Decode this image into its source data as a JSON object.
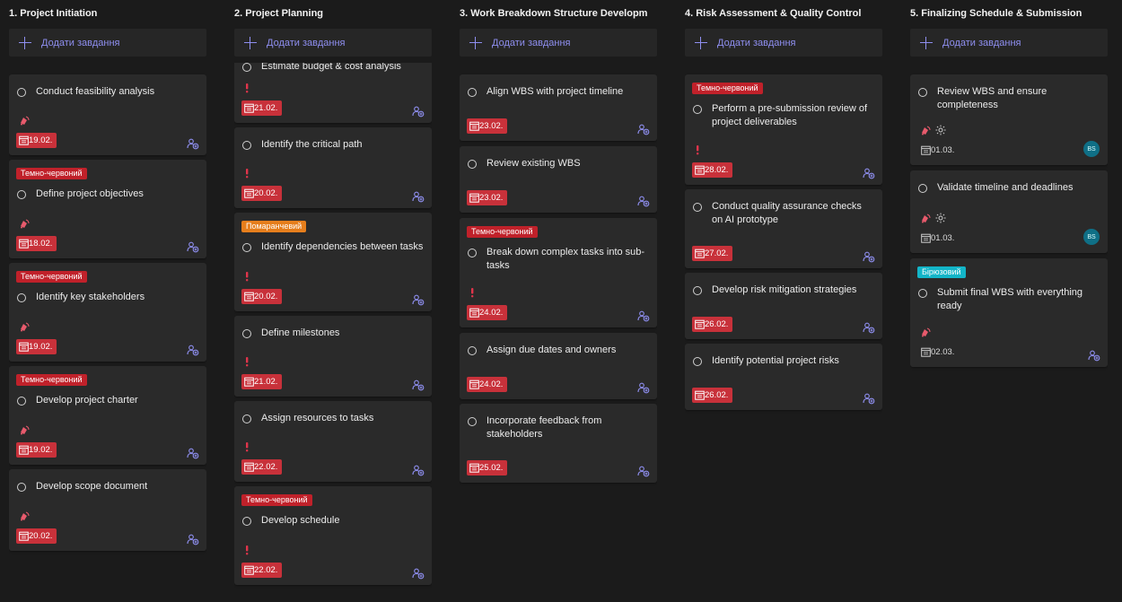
{
  "add_task_label": "Додати завдання",
  "colors": {
    "background": "#1b1b1b",
    "card": "#2a2a2a",
    "accent": "#8f8ff0",
    "date_overdue": "#c8313a",
    "label_dark_red": "#c0212a",
    "label_orange": "#e67e1c",
    "label_teal": "#13b5c8",
    "priority": "#e0344b"
  },
  "icons": {
    "add": "plus-icon",
    "complete": "circle-icon",
    "priority": "exclamation-icon",
    "urgent": "bell-icon",
    "low": "sun-icon",
    "due": "calendar-icon",
    "assign": "assign-person-icon"
  },
  "columns": [
    {
      "title": "1. Project Initiation",
      "cards": [
        {
          "title": "Conduct feasibility analysis",
          "icon": "bell",
          "due": "19.02."
        },
        {
          "label": "Темно-червоний",
          "label_color": "dark-red",
          "title": "Define project objectives",
          "icon": "bell",
          "due": "18.02."
        },
        {
          "label": "Темно-червоний",
          "label_color": "dark-red",
          "title": "Identify key stakeholders",
          "icon": "bell",
          "due": "19.02."
        },
        {
          "label": "Темно-червоний",
          "label_color": "dark-red",
          "title": "Develop project charter",
          "icon": "bell",
          "due": "19.02."
        },
        {
          "title": "Develop scope document",
          "icon": "bell",
          "due": "20.02."
        }
      ]
    },
    {
      "title": "2. Project Planning",
      "cards": [
        {
          "title": "Estimate budget & cost analysis",
          "icon": "exclamation",
          "due": "21.02."
        },
        {
          "title": "Identify the critical path",
          "icon": "exclamation",
          "due": "20.02."
        },
        {
          "label": "Помаранчевий",
          "label_color": "orange",
          "title": "Identify dependencies between tasks",
          "icon": "exclamation",
          "due": "20.02."
        },
        {
          "title": "Define milestones",
          "icon": "exclamation",
          "due": "21.02."
        },
        {
          "title": "Assign resources to tasks",
          "icon": "exclamation",
          "due": "22.02."
        },
        {
          "label": "Темно-червоний",
          "label_color": "dark-red",
          "title": "Develop schedule",
          "icon": "exclamation",
          "due": "22.02."
        }
      ]
    },
    {
      "title": "3. Work Breakdown Structure Developm",
      "cards": [
        {
          "title": "Align WBS with project timeline",
          "due": "23.02."
        },
        {
          "title": "Review existing WBS",
          "due": "23.02."
        },
        {
          "label": "Темно-червоний",
          "label_color": "dark-red",
          "title": "Break down complex tasks into sub-tasks",
          "icon": "exclamation",
          "due": "24.02."
        },
        {
          "title": "Assign due dates and owners",
          "due": "24.02."
        },
        {
          "title": "Incorporate feedback from stakeholders",
          "due": "25.02."
        }
      ]
    },
    {
      "title": "4. Risk Assessment & Quality Control",
      "cards": [
        {
          "label": "Темно-червоний",
          "label_color": "dark-red",
          "title": "Perform a pre-submission review of project deliverables",
          "icon": "exclamation",
          "due": "28.02."
        },
        {
          "title": "Conduct quality assurance checks on AI prototype",
          "due": "27.02."
        },
        {
          "title": "Develop risk mitigation strategies",
          "due": "26.02."
        },
        {
          "title": "Identify potential project risks",
          "due": "26.02."
        }
      ]
    },
    {
      "title": "5. Finalizing Schedule & Submission",
      "cards": [
        {
          "title": "Review WBS and ensure completeness",
          "icon": "bell-sun",
          "due": "01.03.",
          "avatar": "BS"
        },
        {
          "title": "Validate timeline and deadlines",
          "icon": "bell-sun",
          "due": "01.03.",
          "avatar": "BS"
        },
        {
          "label": "Бірюзовий",
          "label_color": "teal",
          "title": "Submit final WBS with everything ready",
          "icon": "bell",
          "due": "02.03."
        }
      ]
    }
  ]
}
